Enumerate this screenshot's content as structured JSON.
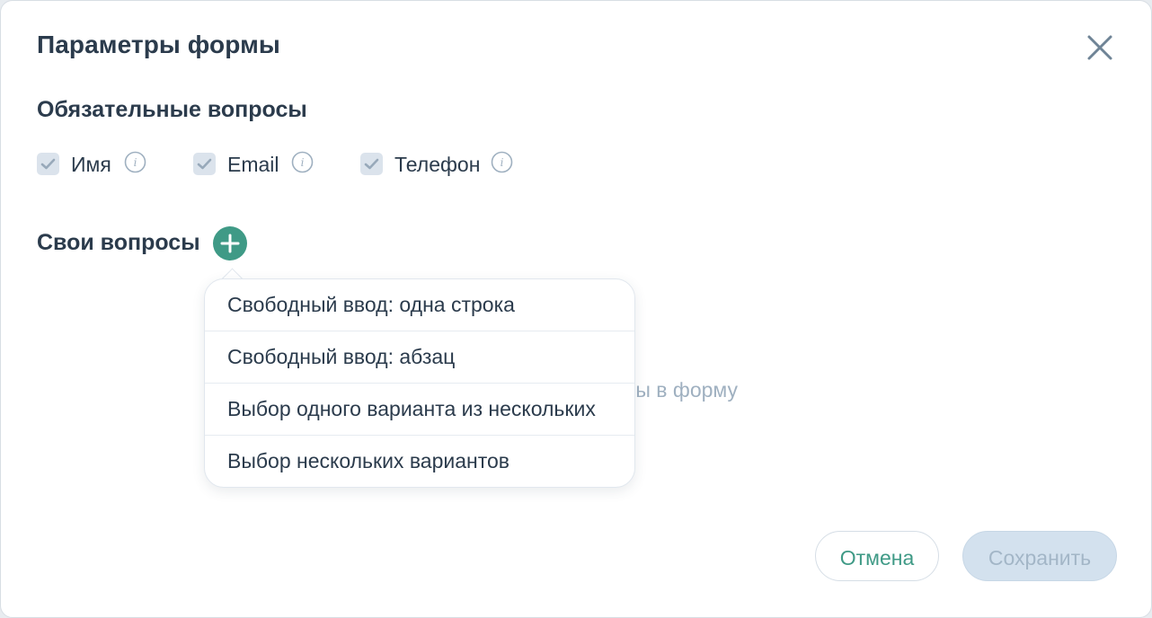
{
  "dialog": {
    "title": "Параметры формы"
  },
  "required": {
    "title": "Обязательные вопросы",
    "items": [
      {
        "label": "Имя",
        "checked": true
      },
      {
        "label": "Email",
        "checked": true
      },
      {
        "label": "Телефон",
        "checked": true
      }
    ]
  },
  "custom": {
    "title": "Свои вопросы",
    "empty_hint_visible_part": "ы в форму"
  },
  "dropdown": {
    "items": [
      "Свободный ввод: одна строка",
      "Свободный ввод: абзац",
      "Выбор одного варианта из нескольких",
      "Выбор нескольких вариантов"
    ]
  },
  "footer": {
    "cancel_label": "Отмена",
    "save_label": "Сохранить"
  },
  "colors": {
    "accent": "#3f9a86",
    "text": "#2b3b4c",
    "muted": "#9fb0c0",
    "disabled_button": "#d3e1ee"
  },
  "icons": {
    "close": "close-icon",
    "check": "check-icon",
    "info": "info-icon",
    "add": "plus-icon"
  }
}
